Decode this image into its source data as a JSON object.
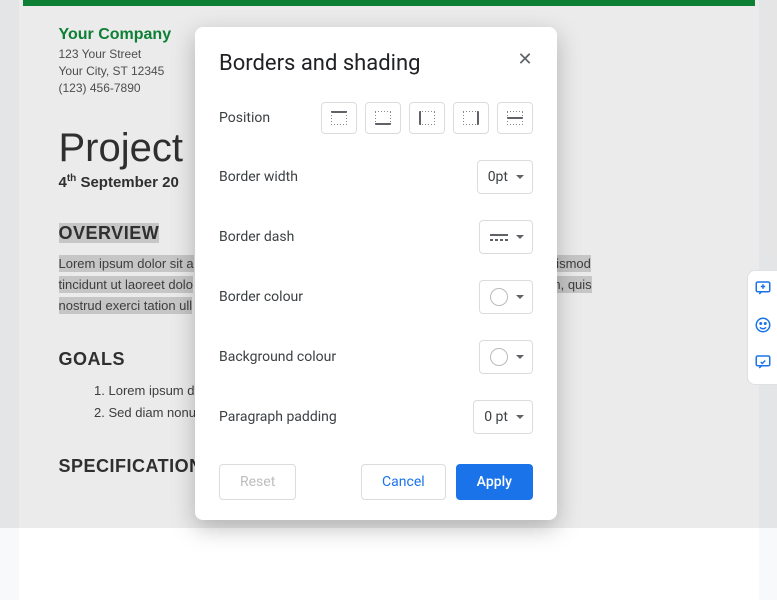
{
  "doc": {
    "company": {
      "name": "Your Company",
      "street": "123 Your Street",
      "city": "Your City, ST 12345",
      "phone": "(123) 456-7890"
    },
    "title": "Project",
    "date_prefix": "4",
    "date_ord": "th",
    "date_rest": " September 20",
    "sections": {
      "overview": {
        "heading": "OVERVIEW",
        "line1_a": "Lorem ipsum dolor sit a",
        "line1_b": "h euismod",
        "line2_a": "tincidunt ut laoreet dolo",
        "line2_b": "eniam, quis",
        "line3": "nostrud exerci tation ull"
      },
      "goals": {
        "heading": "GOALS",
        "items": [
          "Lorem ipsum do",
          "Sed diam nonun                                                                          uam erat volutpat."
        ]
      },
      "specs": {
        "heading": "SPECIFICATIONS"
      }
    }
  },
  "dialog": {
    "title": "Borders and shading",
    "rows": {
      "position": "Position",
      "border_width": {
        "label": "Border width",
        "value": "0pt"
      },
      "border_dash": {
        "label": "Border dash"
      },
      "border_colour": {
        "label": "Border colour"
      },
      "background_colour": {
        "label": "Background colour"
      },
      "paragraph_padding": {
        "label": "Paragraph padding",
        "value": "0 pt"
      }
    },
    "actions": {
      "reset": "Reset",
      "cancel": "Cancel",
      "apply": "Apply"
    }
  }
}
